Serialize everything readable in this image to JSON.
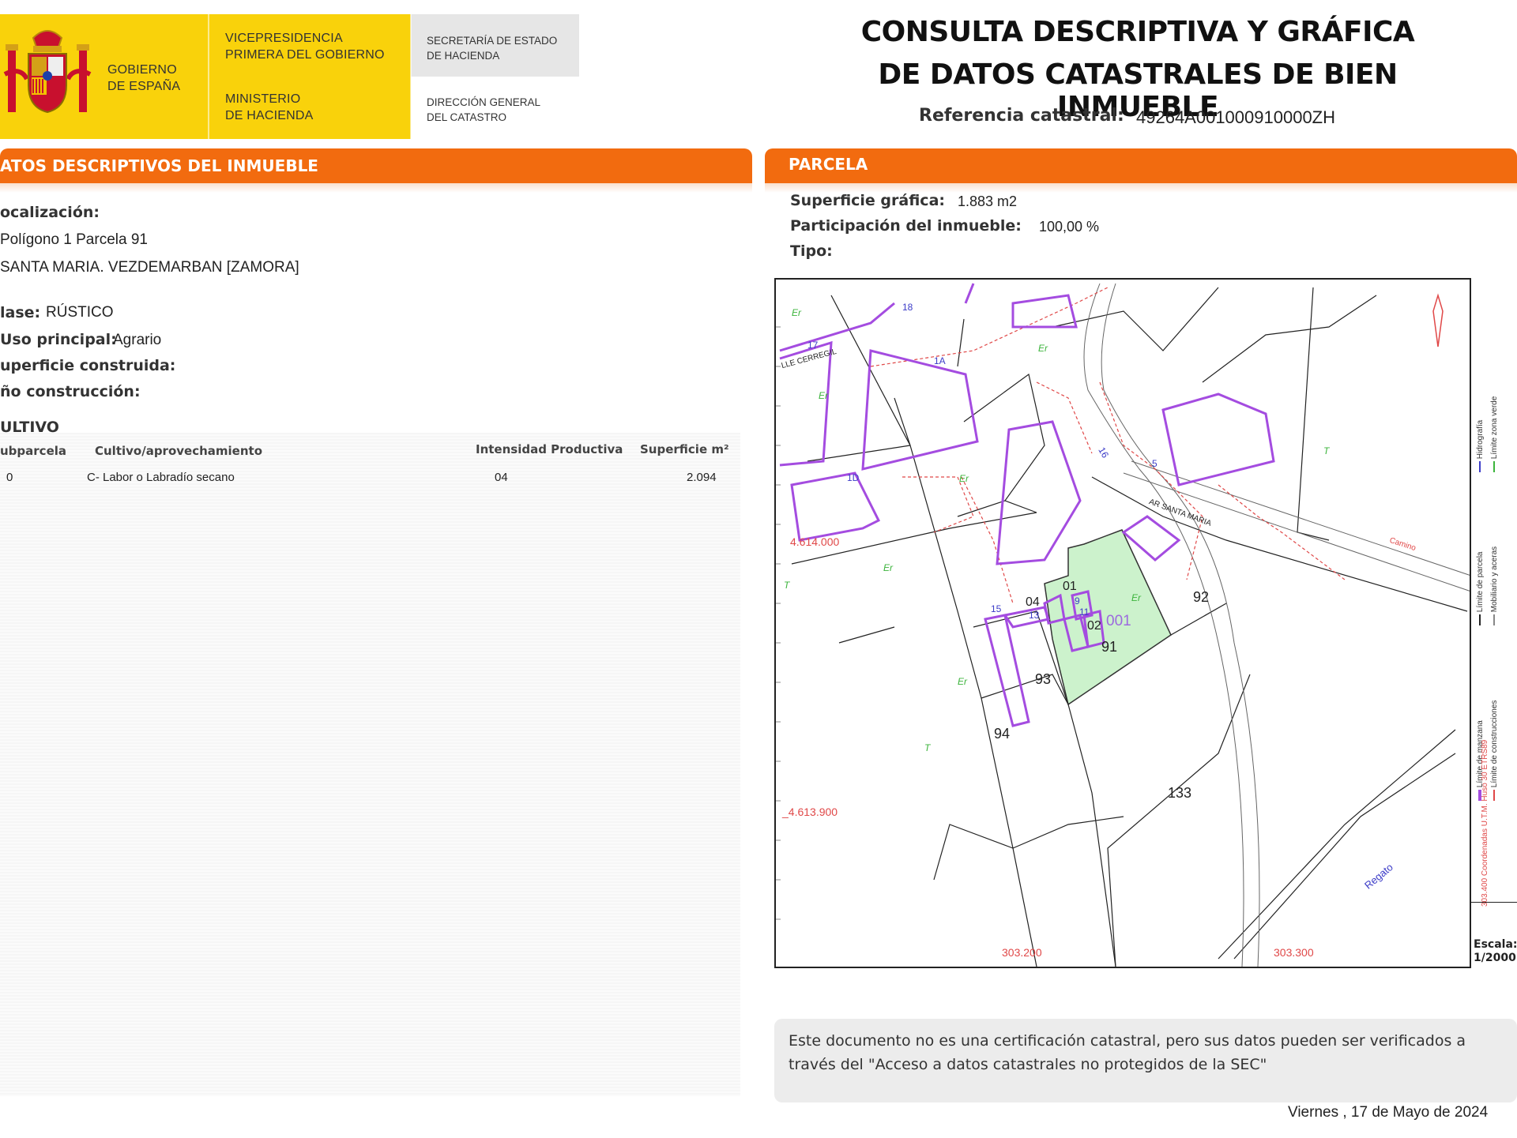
{
  "header": {
    "gov_line1": "GOBIERNO",
    "gov_line2": "DE ESPAÑA",
    "vp_line1": "VICEPRESIDENCIA",
    "vp_line2": "PRIMERA DEL GOBIERNO",
    "min_line1": "MINISTERIO",
    "min_line2": "DE HACIENDA",
    "sec_line1": "SECRETARÍA DE ESTADO",
    "sec_line2": "DE HACIENDA",
    "dg_line1": "DIRECCIÓN GENERAL",
    "dg_line2": "DEL CATASTRO",
    "title_line1": "CONSULTA DESCRIPTIVA Y GRÁFICA",
    "title_line2": "DE DATOS CATASTRALES DE BIEN INMUEBLE",
    "ref_label": "Referencia catastral:",
    "ref_value": "49264A001000910000ZH"
  },
  "descriptivos": {
    "section_title": "ATOS DESCRIPTIVOS DEL INMUEBLE",
    "localizacion_label": "ocalización:",
    "loc_line1": "Polígono 1 Parcela 91",
    "loc_line2": "SANTA MARIA. VEZDEMARBAN [ZAMORA]",
    "clase_label": "lase:",
    "clase_value": "RÚSTICO",
    "uso_label": "Uso principal:",
    "uso_value": "Agrario",
    "superficie_label": "uperficie construida:",
    "anio_label": "ño construcción:",
    "cultivo_title": "ULTIVO",
    "table": {
      "headers": [
        "ubparcela",
        "Cultivo/aprovechamiento",
        "Intensidad Productiva",
        "Superficie m²"
      ],
      "rows": [
        [
          "0",
          "C- Labor o Labradío secano",
          "04",
          "2.094"
        ]
      ]
    }
  },
  "parcela": {
    "section_title": "PARCELA",
    "sup_label": "Superficie gráfica:",
    "sup_value": "1.883 m2",
    "part_label": "Participación del inmueble:",
    "part_value": "100,00 %",
    "tipo_label": "Tipo:"
  },
  "map": {
    "labels": {
      "n91": "91",
      "n92": "92",
      "n93": "93",
      "n94": "94",
      "n133": "133",
      "n001": "001",
      "n01": "01",
      "n02": "02",
      "n04": "04",
      "n9": "9",
      "n11": "11",
      "n13": "13",
      "n15": "15",
      "n5": "5",
      "n16": "16",
      "n18": "18",
      "n17": "17",
      "n1a": "1A",
      "n1d": "1D",
      "street1": "LLE CERREGIL",
      "street2": "AR SANTA MARIA",
      "regato": "Regato",
      "camino": "Camino",
      "er": "Er",
      "t": "T"
    },
    "coords": {
      "y1": "4.614.000",
      "y2": "_4.613.900",
      "x1": "303.200",
      "x2": "303.300"
    },
    "legend": {
      "hidro": "Hidrografía",
      "zona_verde": "Límite zona verde",
      "limite_parcela": "Límite de parcela",
      "mobiliario": "Mobiliario y aceras",
      "limite_manzana": "Límite de manzana",
      "limite_construcciones": "Límite de construcciones",
      "coords_note": "303.400 Coordenadas U.T.M. Huso 30 ETRS89",
      "escala_label": "Escala:",
      "escala_value": "1/2000"
    },
    "colors": {
      "parcel_fill": "#ccf2cc",
      "building": "#a44ce0",
      "red_line": "#e04848",
      "orange": "#f26b0f",
      "yellow": "#f9d20b"
    }
  },
  "note": {
    "line1": "Este documento no es una certificación catastral, pero sus datos pueden ser verificados a",
    "line2": "través del \"Acceso a datos catastrales no protegidos de la SEC\""
  },
  "footer": {
    "date": "Viernes , 17 de Mayo de 2024"
  }
}
